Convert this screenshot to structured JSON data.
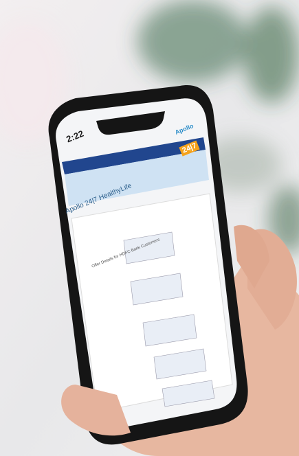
{
  "status_bar": {
    "time": "2:22"
  },
  "brand": {
    "apollo_label": "Apollo",
    "apollo_247": "24|7"
  },
  "page": {
    "title": "Apollo 24|7 HealthyLife",
    "offer_heading": "Offer Details for HDFC Bank Customers"
  },
  "colors": {
    "phone_frame": "#141414",
    "accent_blue": "#2d8ec9",
    "accent_orange": "#f5a21b",
    "hdfc_nav": "#21468e"
  }
}
